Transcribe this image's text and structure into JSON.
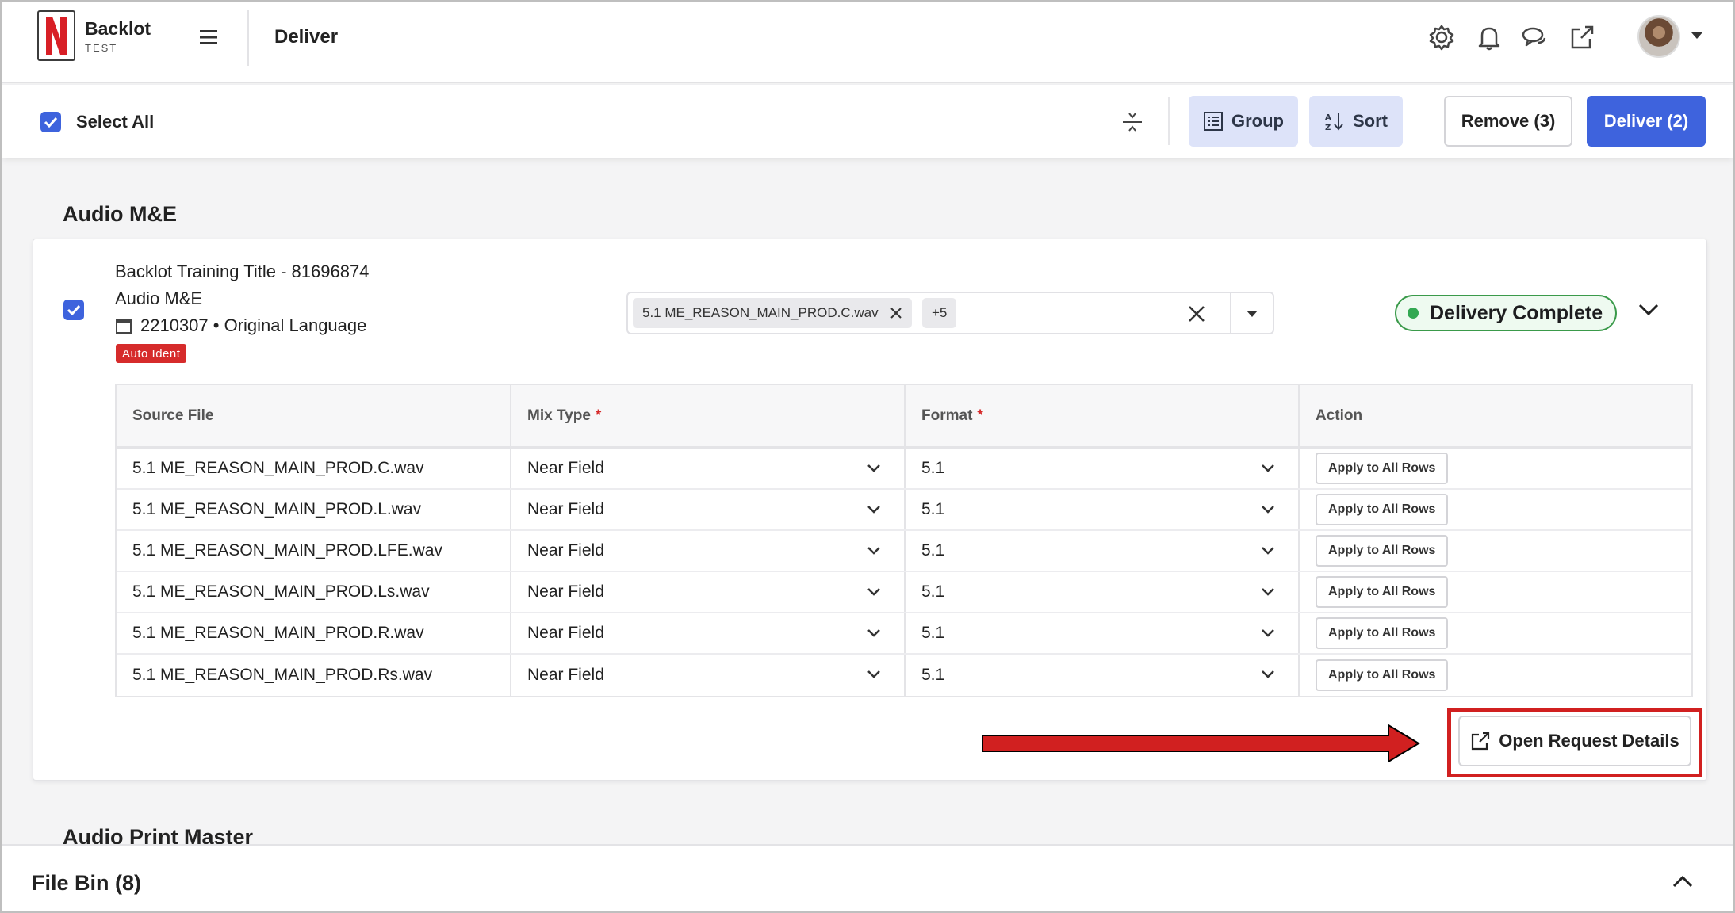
{
  "app": {
    "brand_name": "Backlot",
    "brand_env": "TEST",
    "page_title": "Deliver"
  },
  "toolbar": {
    "select_all_label": "Select All",
    "group_label": "Group",
    "sort_label": "Sort",
    "remove_label": "Remove (3)",
    "deliver_label": "Deliver (2)"
  },
  "sections": {
    "audio_me_title": "Audio M&E",
    "audio_print_master_title": "Audio Print Master"
  },
  "card": {
    "title_line": "Backlot Training Title - 81696874",
    "type_line": "Audio M&E",
    "request_line": "2210307 • Original Language",
    "badge": "Auto Ident",
    "selected_chip": "5.1 ME_REASON_MAIN_PROD.C.wav",
    "more_chip": "+5",
    "status": "Delivery Complete",
    "status_color": "#33a852",
    "open_request_label": "Open Request Details"
  },
  "table": {
    "headers": {
      "source_file": "Source File",
      "mix_type": "Mix Type",
      "format": "Format",
      "action": "Action",
      "required_mark": "*"
    },
    "rows": [
      {
        "source": "5.1 ME_REASON_MAIN_PROD.C.wav",
        "mix": "Near Field",
        "format": "5.1",
        "action": "Apply to All Rows"
      },
      {
        "source": "5.1 ME_REASON_MAIN_PROD.L.wav",
        "mix": "Near Field",
        "format": "5.1",
        "action": "Apply to All Rows"
      },
      {
        "source": "5.1 ME_REASON_MAIN_PROD.LFE.wav",
        "mix": "Near Field",
        "format": "5.1",
        "action": "Apply to All Rows"
      },
      {
        "source": "5.1 ME_REASON_MAIN_PROD.Ls.wav",
        "mix": "Near Field",
        "format": "5.1",
        "action": "Apply to All Rows"
      },
      {
        "source": "5.1 ME_REASON_MAIN_PROD.R.wav",
        "mix": "Near Field",
        "format": "5.1",
        "action": "Apply to All Rows"
      },
      {
        "source": "5.1 ME_REASON_MAIN_PROD.Rs.wav",
        "mix": "Near Field",
        "format": "5.1",
        "action": "Apply to All Rows"
      }
    ]
  },
  "file_bin": {
    "title": "File Bin (8)"
  },
  "colors": {
    "accent": "#3e63dd",
    "soft_button": "#dde3f9",
    "highlight": "#d12020",
    "badge": "#d62b2b"
  },
  "icons": [
    "netflix-logo",
    "menu-icon",
    "settings-icon",
    "bell-icon",
    "chat-icon",
    "external-link-icon",
    "avatar",
    "collapse-rows-icon",
    "list-icon",
    "sort-az-icon",
    "checkbox-checked-icon",
    "calendar-icon",
    "close-icon",
    "chevron-down-icon",
    "chevron-up-icon",
    "arrow-right-icon"
  ]
}
